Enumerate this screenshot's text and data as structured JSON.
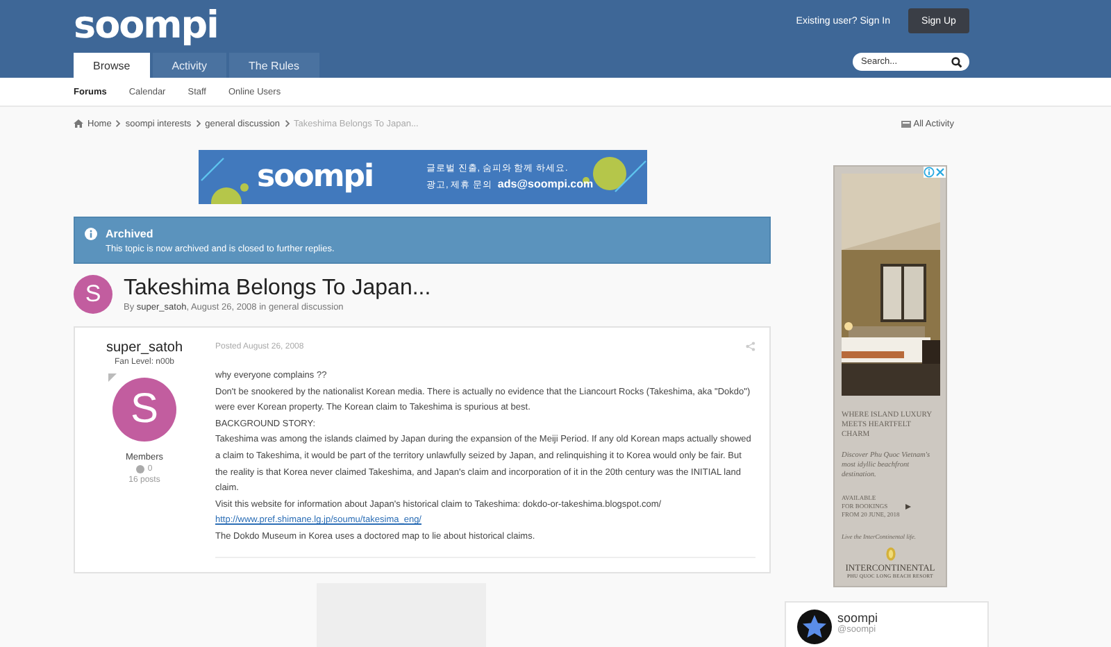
{
  "header": {
    "logo": "soompi",
    "sign_in": "Existing user? Sign In",
    "sign_up": "Sign Up",
    "search": {
      "placeholder": "Search..."
    },
    "tabs": [
      {
        "label": "Browse",
        "selected": true
      },
      {
        "label": "Activity",
        "selected": false
      },
      {
        "label": "The Rules",
        "selected": false
      }
    ]
  },
  "subnav": [
    {
      "label": "Forums",
      "selected": true
    },
    {
      "label": "Calendar",
      "selected": false
    },
    {
      "label": "Staff",
      "selected": false
    },
    {
      "label": "Online Users",
      "selected": false
    }
  ],
  "breadcrumb": {
    "items": [
      {
        "label": "Home",
        "current": false
      },
      {
        "label": "soompi interests",
        "current": false
      },
      {
        "label": "general discussion",
        "current": false
      },
      {
        "label": "Takeshima Belongs To Japan...",
        "current": true
      }
    ],
    "all_activity": "All Activity"
  },
  "banner": {
    "logo": "soompi",
    "line_1": "글로벌 진출, 숨피와 함께 하세요.",
    "line_2": "광고, 제휴 문의",
    "email": "ads@soompi.com"
  },
  "notice": {
    "title": "Archived",
    "text": "This topic is now archived and is closed to further replies."
  },
  "topic": {
    "avatar_letter": "S",
    "title": "Takeshima Belongs To Japan...",
    "byline": "By **super_satoh**, August 26, 2008 in general discussion"
  },
  "post": {
    "author": "super_satoh",
    "fan_level": "Fan Level: n00b",
    "avatar_letter": "S",
    "group": "Members",
    "reputation": "0",
    "posts": "16 posts",
    "posted": "Posted August 26, 2008",
    "paragraphs": [
      {
        "kind": "text",
        "text": "why everyone complains ??"
      },
      {
        "kind": "text",
        "text": "Don't be snookered by the nationalist Korean media. There is actually no evidence that the Liancourt Rocks (Takeshima, aka \"Dokdo\") were ever Korean property. The Korean claim to Takeshima is spurious at best."
      },
      {
        "kind": "text",
        "text": "BACKGROUND STORY:"
      },
      {
        "kind": "text",
        "text": "Takeshima was among the islands claimed by Japan during the expansion of the Meiji Period. If any old Korean maps actually showed a claim to Takeshima, it would be part of the territory unlawfully seized by Japan, and relinquishing it to Korea would only be fair. But the reality is that Korea never claimed Takeshima, and Japan's claim and incorporation of it in the 20th century was the INITIAL land claim."
      },
      {
        "kind": "text",
        "text": "Visit this website for information about Japan's historical claim to Takeshima: dokdo-or-takeshima.blogspot.com/"
      },
      {
        "kind": "link",
        "text": "http://www.pref.shimane.lg.jp/soumu/takesima_eng/"
      },
      {
        "kind": "text",
        "text": "The Dokdo Museum in Korea uses a doctored map to lie about historical claims."
      }
    ]
  },
  "side_ad": {
    "headline": "WHERE ISLAND LUXURY MEETS HEARTFELT CHARM",
    "tagline": "Discover Phu Quoc Vietnam's most idyllic beachfront destination.",
    "availability": [
      "AVAILABLE",
      "FOR BOOKINGS",
      "FROM 20 JUNE, 2018"
    ],
    "slogan": "Live the InterContinental life.",
    "brand": "INTERCONTINENTAL",
    "resort": "PHU QUOC LONG BEACH RESORT"
  },
  "twitter": {
    "name": "soompi",
    "handle": "@soompi"
  }
}
